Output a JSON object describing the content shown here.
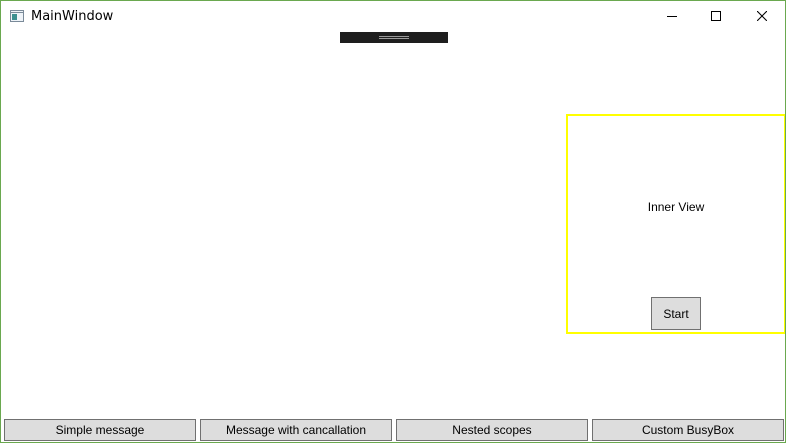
{
  "window": {
    "title": "MainWindow",
    "border_color": "#6aa84f"
  },
  "caption_buttons": {
    "minimize_icon": "minimize-icon",
    "maximize_icon": "maximize-icon",
    "close_icon": "close-icon"
  },
  "inner_view": {
    "label": "Inner View",
    "border_color": "#ffff00",
    "start_label": "Start"
  },
  "bottom_buttons": [
    {
      "label": "Simple message"
    },
    {
      "label": "Message with cancallation"
    },
    {
      "label": "Nested scopes"
    },
    {
      "label": "Custom BusyBox"
    }
  ]
}
